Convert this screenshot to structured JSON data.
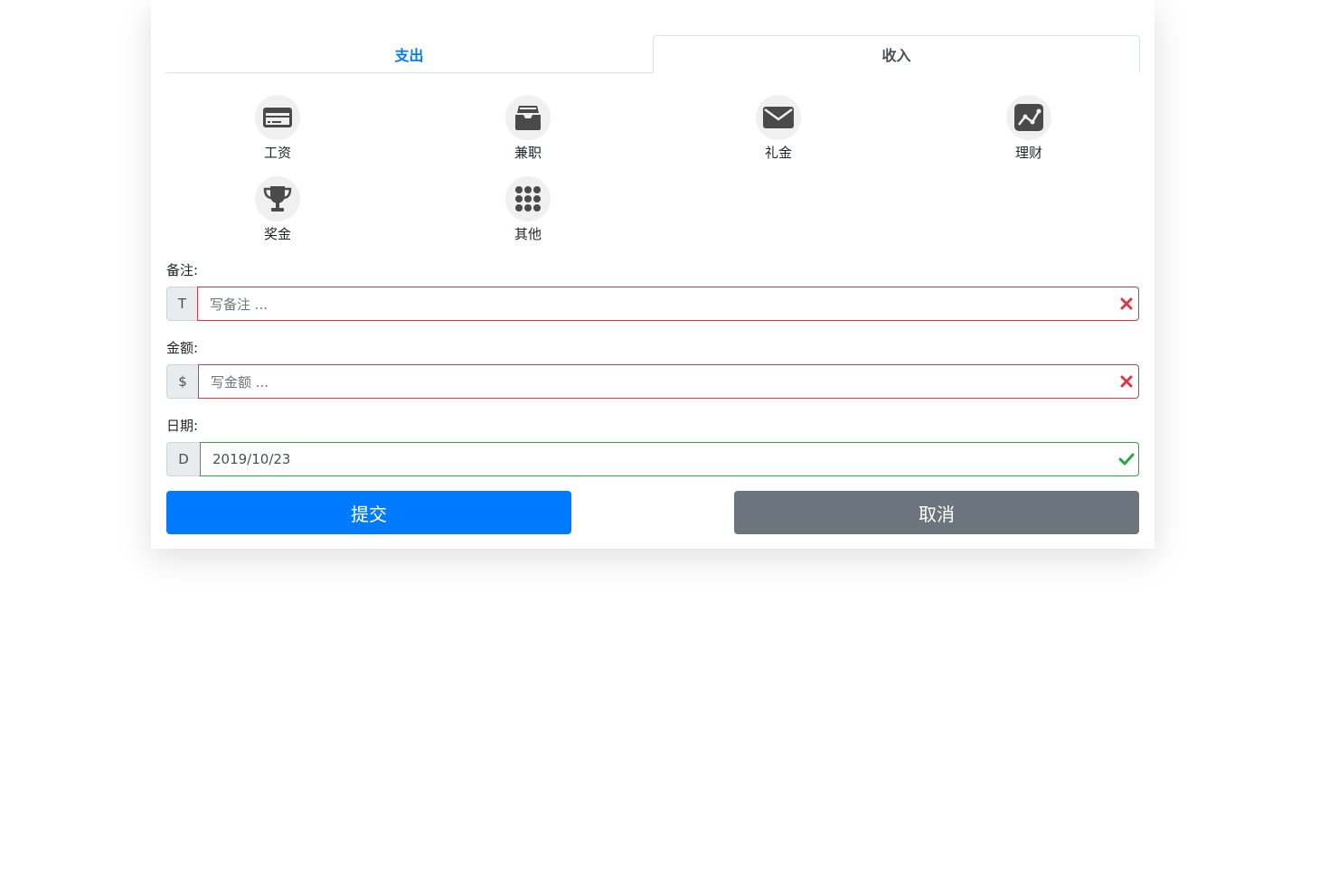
{
  "tabs": {
    "expense": "支出",
    "income": "收入"
  },
  "categories": [
    {
      "label": "工资",
      "icon": "credit-card-icon"
    },
    {
      "label": "兼职",
      "icon": "inbox-icon"
    },
    {
      "label": "礼金",
      "icon": "envelope-icon"
    },
    {
      "label": "理财",
      "icon": "chart-line-icon"
    },
    {
      "label": "奖金",
      "icon": "trophy-icon"
    },
    {
      "label": "其他",
      "icon": "grid-dots-icon"
    }
  ],
  "form": {
    "note": {
      "label": "备注:",
      "prefix": "T",
      "placeholder": "写备注 ...",
      "value": ""
    },
    "amount": {
      "label": "金额:",
      "prefix": "$",
      "placeholder": "写金额 ...",
      "value": ""
    },
    "date": {
      "label": "日期:",
      "prefix": "D",
      "value": "2019/10/23"
    }
  },
  "buttons": {
    "submit": "提交",
    "cancel": "取消"
  },
  "colors": {
    "primary": "#007bff",
    "secondary": "#6c757d",
    "invalid": "#dc3545",
    "valid": "#28a745",
    "icon": "#4a4a4a"
  }
}
